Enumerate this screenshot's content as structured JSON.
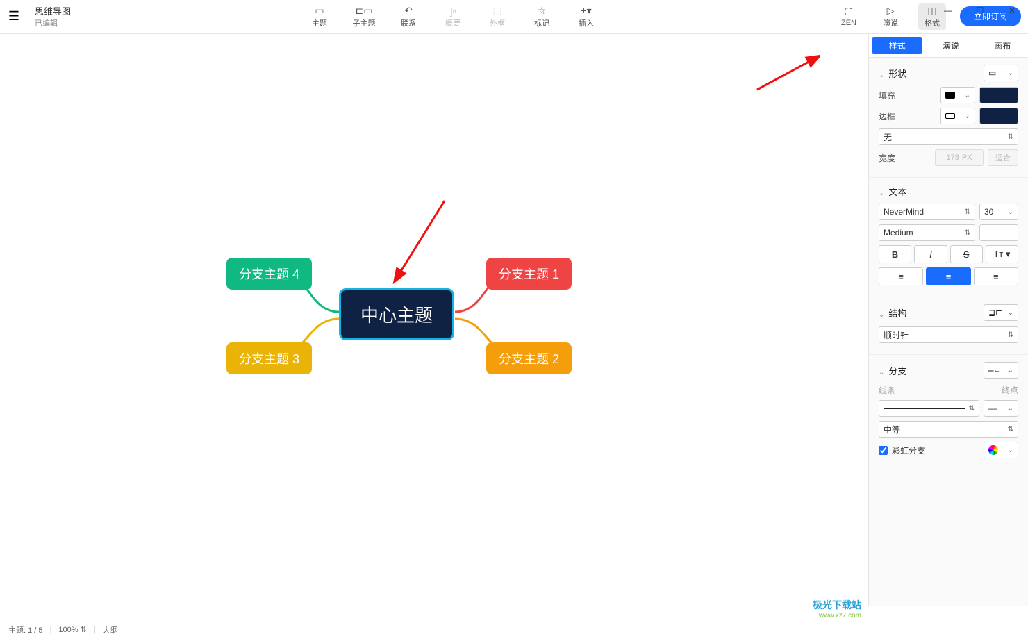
{
  "window": {
    "title": "思维导图",
    "subtitle": "已编辑"
  },
  "toolbar": {
    "topic": "主题",
    "subtopic": "子主题",
    "relation": "联系",
    "summary": "概要",
    "boundary": "外框",
    "marker": "标记",
    "insert": "插入",
    "zen": "ZEN",
    "pitch": "演说",
    "format": "格式",
    "subscribe": "立即订阅"
  },
  "canvas": {
    "center": "中心主题",
    "b1": "分支主题 1",
    "b2": "分支主题 2",
    "b3": "分支主题 3",
    "b4": "分支主题 4"
  },
  "panel": {
    "tabs": {
      "style": "样式",
      "pitch": "演说",
      "canvas": "画布"
    },
    "shape": {
      "head": "形状",
      "fill": "填充",
      "border": "边框",
      "none": "无",
      "width": "宽度",
      "width_val": "178",
      "px": "PX",
      "fit": "适合"
    },
    "text": {
      "head": "文本",
      "font": "NeverMind",
      "size": "30",
      "weight": "Medium"
    },
    "struct": {
      "head": "结构",
      "clockwise": "顺时针"
    },
    "branch": {
      "head": "分支",
      "line": "线条",
      "end": "终点",
      "medium": "中等",
      "rainbow": "彩虹分支"
    }
  },
  "status": {
    "topics": "主题: 1 / 5",
    "zoom": "100%",
    "outline": "大纲"
  },
  "watermark": {
    "l1": "极光下载站",
    "l2": "www.xz7.com"
  }
}
